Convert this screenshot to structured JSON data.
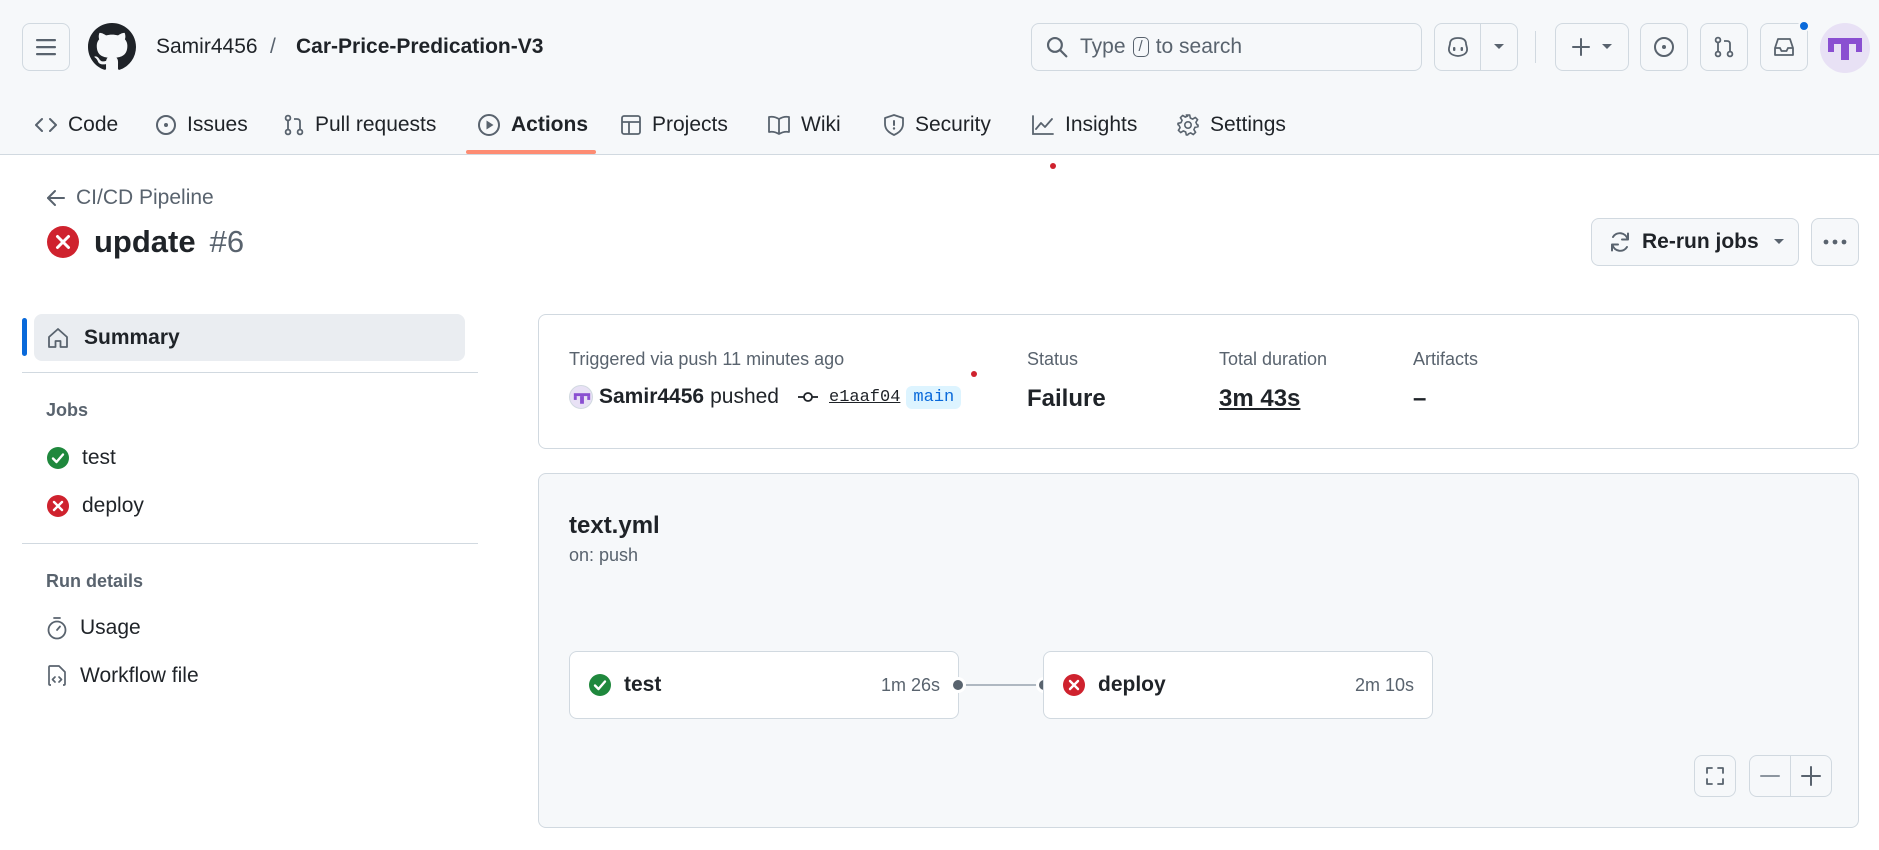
{
  "header": {
    "owner": "Samir4456",
    "separator": "/",
    "repo": "Car-Price-Predication-V3",
    "search": {
      "prefix": "Type",
      "key": "/",
      "suffix": "to search"
    }
  },
  "nav": {
    "tabs": [
      {
        "label": "Code",
        "icon": "code-icon"
      },
      {
        "label": "Issues",
        "icon": "issue-icon"
      },
      {
        "label": "Pull requests",
        "icon": "pull-request-icon"
      },
      {
        "label": "Actions",
        "icon": "play-icon",
        "selected": true
      },
      {
        "label": "Projects",
        "icon": "table-icon"
      },
      {
        "label": "Wiki",
        "icon": "book-icon"
      },
      {
        "label": "Security",
        "icon": "shield-icon"
      },
      {
        "label": "Insights",
        "icon": "graph-icon"
      },
      {
        "label": "Settings",
        "icon": "gear-icon"
      }
    ]
  },
  "run": {
    "workflow": "CI/CD Pipeline",
    "title": "update",
    "number": "#6",
    "status_color": "#cf222e",
    "rerun_label": "Re-run jobs"
  },
  "sidebar": {
    "summary_label": "Summary",
    "jobs_heading": "Jobs",
    "jobs": [
      {
        "label": "test",
        "status": "success"
      },
      {
        "label": "deploy",
        "status": "failure"
      }
    ],
    "details_heading": "Run details",
    "details": [
      {
        "label": "Usage",
        "icon": "stopwatch-icon"
      },
      {
        "label": "Workflow file",
        "icon": "file-code-icon"
      }
    ]
  },
  "summary": {
    "trigger_text": "Triggered via push 11 minutes ago",
    "actor": "Samir4456",
    "action": "pushed",
    "commit": "e1aaf04",
    "branch": "main",
    "status_label": "Status",
    "status_value": "Failure",
    "duration_label": "Total duration",
    "duration_value": "3m 43s",
    "artifacts_label": "Artifacts",
    "artifacts_value": "–"
  },
  "graph": {
    "file": "text.yml",
    "trigger": "on: push",
    "jobs": [
      {
        "name": "test",
        "duration": "1m 26s",
        "status": "success"
      },
      {
        "name": "deploy",
        "duration": "2m 10s",
        "status": "failure"
      }
    ]
  },
  "colors": {
    "success": "#1f883d",
    "failure": "#cf222e",
    "accent": "#0969da",
    "tab_underline": "#fd8c73"
  }
}
